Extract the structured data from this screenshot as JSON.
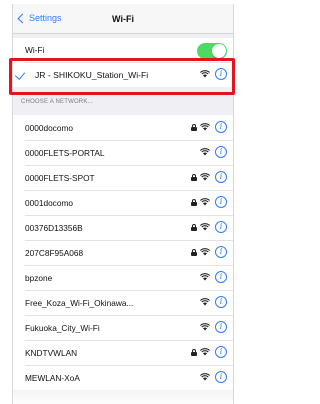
{
  "nav": {
    "back_label": "Settings",
    "title": "Wi-Fi"
  },
  "wifi_toggle": {
    "label": "Wi-Fi",
    "on": true,
    "on_color": "#4cd964"
  },
  "connected_network": {
    "name": "JR - SHIKOKU_Station_Wi-Fi",
    "highlight_color": "#e3141b"
  },
  "section_header": "CHOOSE A NETWORK...",
  "networks": [
    {
      "name": "0000docomo",
      "locked": true
    },
    {
      "name": "0000FLETS-PORTAL",
      "locked": false
    },
    {
      "name": "0000FLETS-SPOT",
      "locked": true
    },
    {
      "name": "0001docomo",
      "locked": true
    },
    {
      "name": "00376D13356B",
      "locked": true
    },
    {
      "name": "207C8F95A068",
      "locked": true
    },
    {
      "name": "bpzone",
      "locked": false
    },
    {
      "name": "Free_Koza_Wi-Fi_Okinawa...",
      "locked": false
    },
    {
      "name": "Fukuoka_City_Wi-Fi",
      "locked": false
    },
    {
      "name": "KNDTVWLAN",
      "locked": true
    },
    {
      "name": "MEWLAN-XoA",
      "locked": false
    }
  ],
  "icons": {
    "lock": "lock-icon",
    "wifi": "wifi-icon",
    "info": "info-icon",
    "back": "chevron-left-icon",
    "check": "checkmark-icon"
  },
  "accent_color": "#2f7cf6"
}
